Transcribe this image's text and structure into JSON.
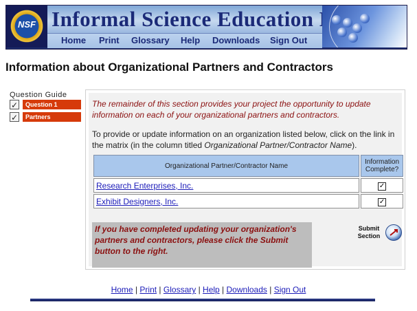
{
  "banner": {
    "logo_text": "NSF",
    "title": "Informal Science Education Program",
    "nav": [
      "Home",
      "Print",
      "Glossary",
      "Help",
      "Downloads",
      "Sign Out"
    ]
  },
  "page_title": "Information about Organizational Partners and Contractors",
  "question_guide": {
    "label": "Question Guide",
    "items": [
      {
        "label": "Question 1",
        "checked": true
      },
      {
        "label": "Partners",
        "checked": true
      }
    ]
  },
  "content": {
    "intro": "The remainder of this section provides your project the opportunity to update information on each of your organizational partners and contractors.",
    "para_before": "To provide or update information on an organization listed below, click on the link in the matrix (in the column titled ",
    "para_italic": "Organizational Partner/Contractor Name",
    "para_after": ").",
    "table": {
      "headers": [
        "Organizational Partner/Contractor Name",
        "Information Complete?"
      ],
      "rows": [
        {
          "name": "Research Enterprises, Inc.",
          "complete": true
        },
        {
          "name": "Exhibit Designers, Inc.",
          "complete": true
        }
      ]
    },
    "note": "If you have completed updating your organization's partners and contractors, please click the Submit button to the right.",
    "submit_label": "Submit Section"
  },
  "footer": {
    "links": [
      "Home",
      "Print",
      "Glossary",
      "Help",
      "Downloads",
      "Sign Out"
    ],
    "separator": " | "
  }
}
